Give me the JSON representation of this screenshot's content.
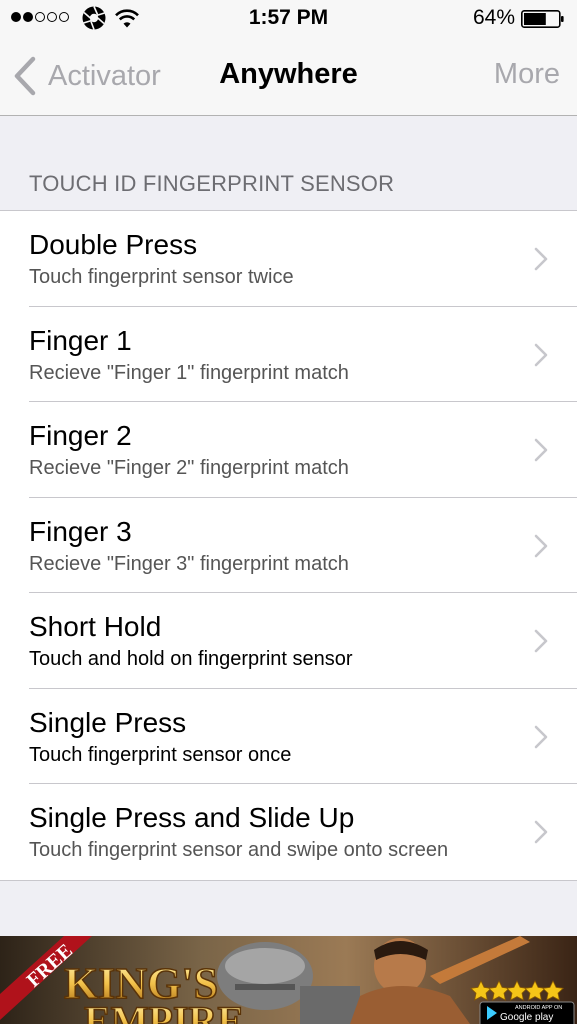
{
  "status_bar": {
    "signal_bars_filled": 2,
    "signal_bars_total": 5,
    "carrier_icon": "aperture-icon",
    "wifi_icon": "wifi-icon",
    "time": "1:57 PM",
    "battery_percent": "64%",
    "battery_level": 0.64
  },
  "nav": {
    "back_label": "Activator",
    "title": "Anywhere",
    "right_label": "More"
  },
  "section": {
    "header": "TOUCH ID FINGERPRINT SENSOR"
  },
  "rows": [
    {
      "title": "Double Press",
      "subtitle": "Touch fingerprint sensor twice"
    },
    {
      "title": "Finger 1",
      "subtitle": "Recieve \"Finger 1\" fingerprint match"
    },
    {
      "title": "Finger 2",
      "subtitle": "Recieve \"Finger 2\" fingerprint match"
    },
    {
      "title": "Finger 3",
      "subtitle": "Recieve \"Finger 3\" fingerprint match"
    },
    {
      "title": "Short Hold",
      "subtitle": "Touch and hold on fingerprint sensor"
    },
    {
      "title": "Single Press",
      "subtitle": "Touch fingerprint sensor once"
    },
    {
      "title": "Single Press and Slide Up",
      "subtitle": "Touch fingerprint sensor and swipe onto screen"
    }
  ],
  "ad": {
    "ribbon": "FREE",
    "title_line1": "KING'S",
    "title_line2": "EMPIRE",
    "rating_stars": 5,
    "store_badge_top": "ANDROID APP ON",
    "store_badge_main": "Google play"
  },
  "colors": {
    "nav_inactive": "#a8a8ad",
    "background": "#efeff4",
    "separator": "#c8c7cc",
    "chevron": "#c7c7cc"
  }
}
